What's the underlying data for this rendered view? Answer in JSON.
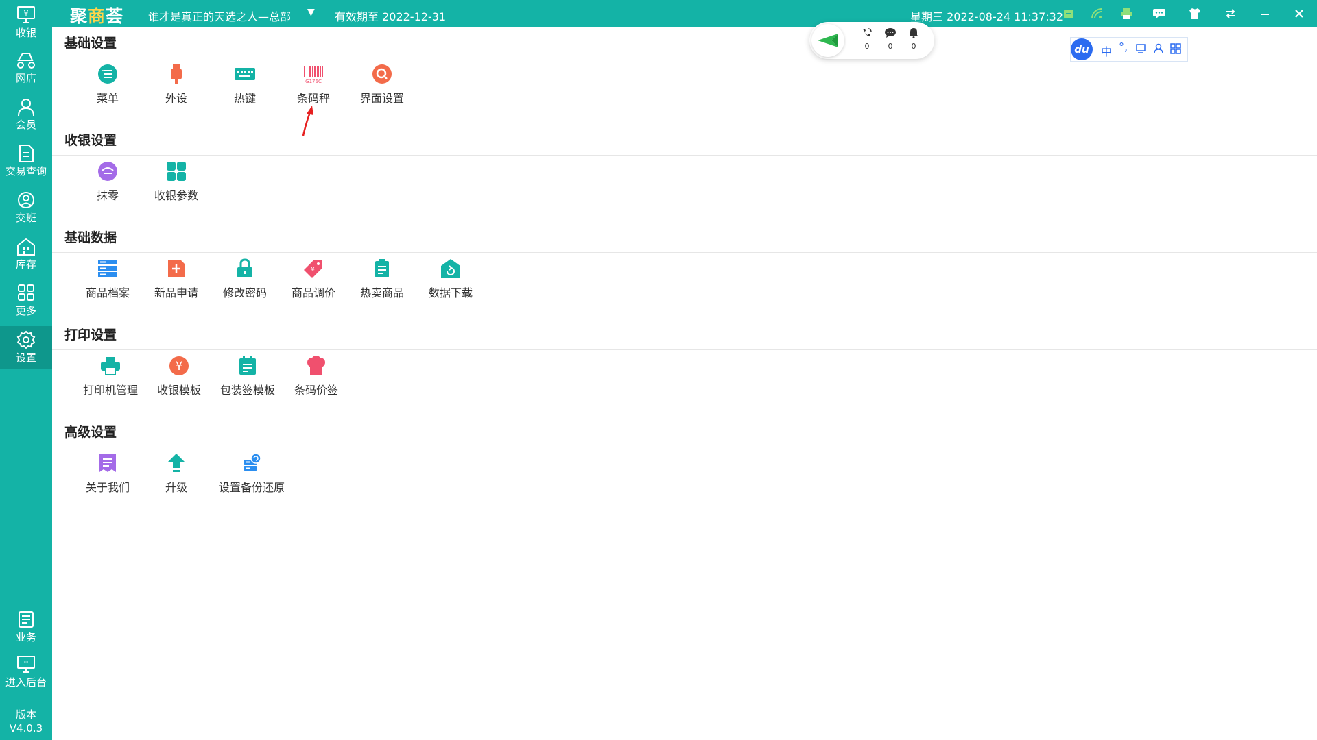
{
  "header": {
    "logo": {
      "part1": "聚",
      "part2": "商",
      "part3": "荟"
    },
    "store_name": "谁才是真正的天选之人—总部",
    "validity": "有效期至 2022-12-31",
    "datetime": "星期三 2022-08-24 11:37:32",
    "icons": [
      "sync-status-icon",
      "wifi-icon",
      "printer-icon",
      "message-icon",
      "skin-icon",
      "switch-icon",
      "minimize-icon",
      "close-icon"
    ]
  },
  "sidebar": {
    "items": [
      {
        "label": "收银",
        "icon": "cashier-icon"
      },
      {
        "label": "网店",
        "icon": "online-store-icon"
      },
      {
        "label": "会员",
        "icon": "member-icon"
      },
      {
        "label": "交易查询",
        "icon": "transaction-query-icon"
      },
      {
        "label": "交班",
        "icon": "shift-handover-icon"
      },
      {
        "label": "库存",
        "icon": "inventory-icon"
      },
      {
        "label": "更多",
        "icon": "more-icon"
      },
      {
        "label": "设置",
        "icon": "settings-icon",
        "active": true
      }
    ],
    "bottom": [
      {
        "label": "业务",
        "icon": "business-icon"
      },
      {
        "label": "进入后台",
        "icon": "backend-icon"
      }
    ],
    "version_label": "版本",
    "version": "V4.0.3"
  },
  "sections": [
    {
      "title": "基础设置",
      "items": [
        {
          "label": "菜单",
          "icon": "menu-icon",
          "color": "#14b3a6"
        },
        {
          "label": "外设",
          "icon": "peripheral-icon",
          "color": "#f36b4a"
        },
        {
          "label": "热键",
          "icon": "keyboard-icon",
          "color": "#14b3a6"
        },
        {
          "label": "条码秤",
          "icon": "barcode-icon",
          "color": "#f0506e"
        },
        {
          "label": "界面设置",
          "icon": "interface-settings-icon",
          "color": "#f36b4a"
        }
      ]
    },
    {
      "title": "收银设置",
      "items": [
        {
          "label": "抹零",
          "icon": "rounding-icon",
          "color": "#a46be8"
        },
        {
          "label": "收银参数",
          "icon": "cashier-params-icon",
          "color": "#14b3a6"
        }
      ]
    },
    {
      "title": "基础数据",
      "items": [
        {
          "label": "商品档案",
          "icon": "product-archive-icon",
          "color": "#2b8ef0"
        },
        {
          "label": "新品申请",
          "icon": "new-product-icon",
          "color": "#f36b4a"
        },
        {
          "label": "修改密码",
          "icon": "lock-icon",
          "color": "#14b3a6"
        },
        {
          "label": "商品调价",
          "icon": "price-tag-icon",
          "color": "#f0506e"
        },
        {
          "label": "热卖商品",
          "icon": "hot-product-icon",
          "color": "#14b3a6"
        },
        {
          "label": "数据下载",
          "icon": "data-download-icon",
          "color": "#14b3a6"
        }
      ]
    },
    {
      "title": "打印设置",
      "items": [
        {
          "label": "打印机管理",
          "icon": "printer-manage-icon",
          "color": "#14b3a6"
        },
        {
          "label": "收银模板",
          "icon": "yen-template-icon",
          "color": "#f36b4a"
        },
        {
          "label": "包装签模板",
          "icon": "package-label-icon",
          "color": "#14b3a6"
        },
        {
          "label": "条码价签",
          "icon": "barcode-label-icon",
          "color": "#f0506e"
        }
      ]
    },
    {
      "title": "高级设置",
      "items": [
        {
          "label": "关于我们",
          "icon": "about-icon",
          "color": "#a46be8"
        },
        {
          "label": "升级",
          "icon": "upgrade-icon",
          "color": "#14b3a6"
        },
        {
          "label": "设置备份还原",
          "icon": "backup-restore-icon",
          "color": "#2b8ef0"
        }
      ]
    }
  ],
  "float_widget": {
    "phone_count": "0",
    "chat_count": "0",
    "bell_count": "0"
  },
  "ime": {
    "logo": "du",
    "lang": "中",
    "punct": "°,"
  },
  "colors": {
    "brand": "#14b3a6",
    "brand_dark": "#0e978c",
    "accent": "#ffd54a"
  }
}
